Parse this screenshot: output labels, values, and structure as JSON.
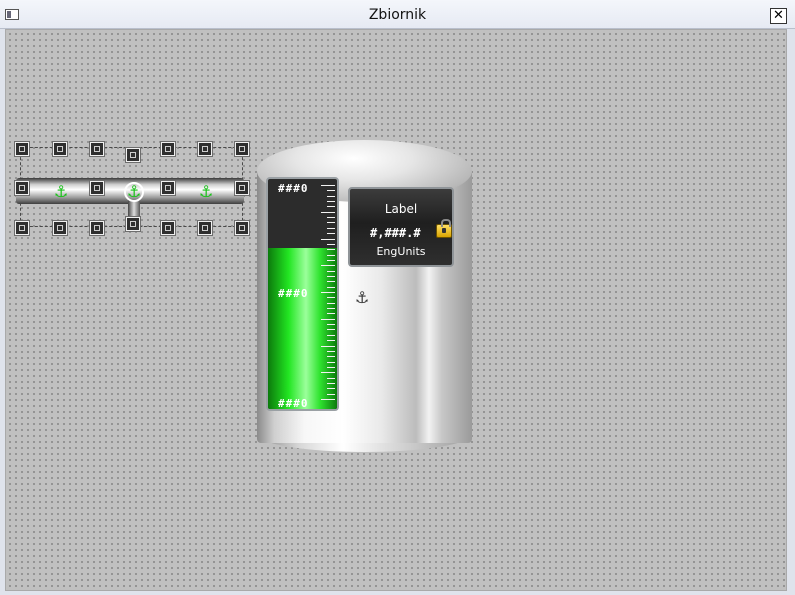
{
  "window": {
    "title": "Zbiornik",
    "close_label": "✕"
  },
  "icons": {
    "system_menu": "window-system-icon",
    "close": "close-icon",
    "anchor": "anchor-icon",
    "lock": "lock-icon",
    "move_cursor": "move-cursor-icon"
  },
  "tank": {
    "level_fraction": 0.7,
    "gauge_labels": [
      "###0",
      "###0",
      "###0"
    ],
    "display": {
      "label": "Label",
      "value": "#,###.#",
      "units": "EngUnits"
    }
  },
  "colors": {
    "canvas": "#c0c0c0",
    "level_fill": "#22e622",
    "gauge_bg": "#2c2c2c"
  }
}
